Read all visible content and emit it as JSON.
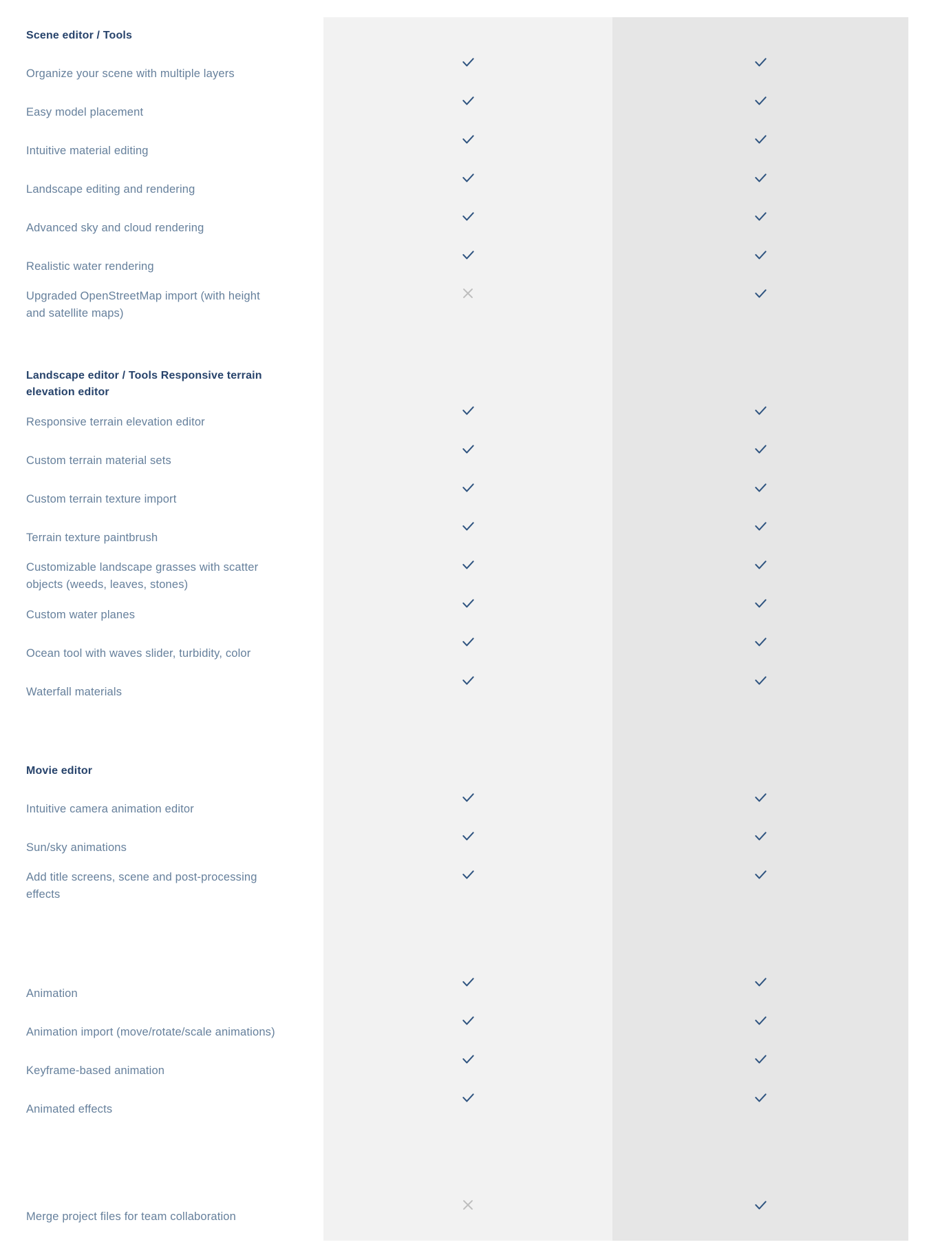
{
  "colors": {
    "section_heading": "#27436b",
    "feature_text": "#66809c",
    "check": "#2f5480",
    "cross": "#bdbdbd",
    "column_a_bg": "#f2f2f2",
    "column_b_bg": "#e6e6e6",
    "page_bg": "#ffffff"
  },
  "icons": {
    "included": "check-icon",
    "excluded": "cross-icon"
  },
  "table": {
    "columns": [
      "column-a",
      "column-b"
    ],
    "rows": [
      {
        "kind": "section",
        "label": "Scene editor / Tools",
        "col_a": "",
        "col_b": ""
      },
      {
        "kind": "feature",
        "label": "Organize your scene with multiple layers",
        "col_a": "check",
        "col_b": "check"
      },
      {
        "kind": "feature",
        "label": "Easy model placement",
        "col_a": "check",
        "col_b": "check"
      },
      {
        "kind": "feature",
        "label": "Intuitive material editing",
        "col_a": "check",
        "col_b": "check"
      },
      {
        "kind": "feature",
        "label": "Landscape editing and rendering",
        "col_a": "check",
        "col_b": "check"
      },
      {
        "kind": "feature",
        "label": "Advanced sky and cloud rendering",
        "col_a": "check",
        "col_b": "check"
      },
      {
        "kind": "feature",
        "label": "Realistic water rendering",
        "col_a": "check",
        "col_b": "check"
      },
      {
        "kind": "feature",
        "label": "Upgraded OpenStreetMap import (with height and satellite maps)",
        "col_a": "cross",
        "col_b": "check"
      },
      {
        "kind": "spacer",
        "label": "",
        "col_a": "",
        "col_b": ""
      },
      {
        "kind": "section",
        "label": "Landscape editor / Tools Responsive terrain elevation editor",
        "col_a": "",
        "col_b": ""
      },
      {
        "kind": "feature",
        "label": "Responsive terrain elevation editor",
        "col_a": "check",
        "col_b": "check"
      },
      {
        "kind": "feature",
        "label": "Custom terrain material sets",
        "col_a": "check",
        "col_b": "check"
      },
      {
        "kind": "feature",
        "label": "Custom terrain texture import",
        "col_a": "check",
        "col_b": "check"
      },
      {
        "kind": "feature",
        "label": "Terrain texture paintbrush",
        "col_a": "check",
        "col_b": "check"
      },
      {
        "kind": "feature",
        "label": "Customizable landscape grasses with scatter objects (weeds, leaves, stones)",
        "col_a": "check",
        "col_b": "check"
      },
      {
        "kind": "feature",
        "label": "Custom water planes",
        "col_a": "check",
        "col_b": "check"
      },
      {
        "kind": "feature",
        "label": "Ocean tool with waves slider, turbidity, color",
        "col_a": "check",
        "col_b": "check"
      },
      {
        "kind": "feature",
        "label": "Waterfall materials",
        "col_a": "check",
        "col_b": "check"
      },
      {
        "kind": "spacer",
        "label": "",
        "col_a": "",
        "col_b": ""
      },
      {
        "kind": "section",
        "label": "Movie editor",
        "col_a": "",
        "col_b": ""
      },
      {
        "kind": "feature",
        "label": "Intuitive camera animation editor",
        "col_a": "check",
        "col_b": "check"
      },
      {
        "kind": "feature",
        "label": "Sun/sky animations",
        "col_a": "check",
        "col_b": "check"
      },
      {
        "kind": "feature",
        "label": "Add title screens, scene and post-processing effects",
        "col_a": "check",
        "col_b": "check"
      },
      {
        "kind": "spacer-tall",
        "label": "",
        "col_a": "",
        "col_b": ""
      },
      {
        "kind": "feature",
        "label": "Animation",
        "col_a": "check",
        "col_b": "check"
      },
      {
        "kind": "feature",
        "label": "Animation import (move/rotate/scale animations)",
        "col_a": "check",
        "col_b": "check"
      },
      {
        "kind": "feature",
        "label": "Keyframe-based animation",
        "col_a": "check",
        "col_b": "check"
      },
      {
        "kind": "feature",
        "label": "Animated effects",
        "col_a": "check",
        "col_b": "check"
      },
      {
        "kind": "spacer-tall",
        "label": "",
        "col_a": "",
        "col_b": ""
      },
      {
        "kind": "feature",
        "label": "Merge project files for team collaboration",
        "col_a": "cross",
        "col_b": "check"
      }
    ]
  }
}
